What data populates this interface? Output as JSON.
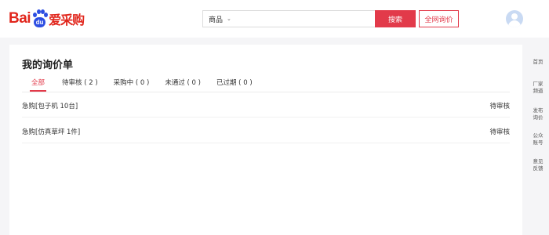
{
  "brand": {
    "bai": "Bai",
    "du": "du",
    "cai": "爱采购"
  },
  "search": {
    "category": "商品",
    "placeholder": "",
    "button_label": "搜索"
  },
  "header": {
    "inquiry_button_label": "全网询价"
  },
  "main": {
    "page_title": "我的询价单",
    "tabs": [
      {
        "label": "全部",
        "active": true
      },
      {
        "label": "待审核 ( 2 )"
      },
      {
        "label": "采购中 ( 0 )"
      },
      {
        "label": "未通过 ( 0 )"
      },
      {
        "label": "已过期 ( 0 )"
      }
    ],
    "rows": [
      {
        "title": "急购[包子机 10台]",
        "status": "待审核"
      },
      {
        "title": "急购[仿真草坪 1件]",
        "status": "待审核"
      }
    ]
  },
  "sidebar": {
    "items": [
      {
        "line1": "首页",
        "line2": ""
      },
      {
        "line1": "厂家",
        "line2": "频道"
      },
      {
        "line1": "发布",
        "line2": "询价"
      },
      {
        "line1": "公众",
        "line2": "账号"
      },
      {
        "line1": "意见",
        "line2": "反馈"
      }
    ]
  },
  "colors": {
    "accent": "#e23a4a",
    "brand_red": "#e1261c",
    "brand_blue": "#2d4ee2"
  }
}
